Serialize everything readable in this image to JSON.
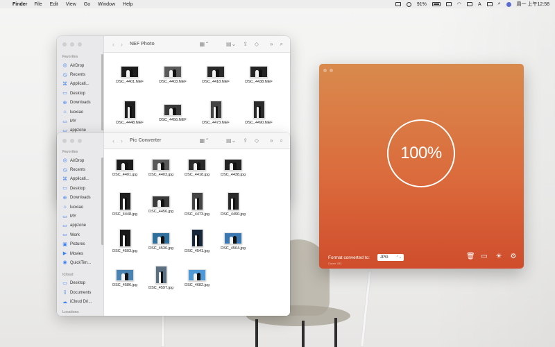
{
  "menubar": {
    "app_name": "Finder",
    "items": [
      "File",
      "Edit",
      "View",
      "Go",
      "Window",
      "Help"
    ],
    "battery_percent": "91%",
    "clock": "周一 上午12:58"
  },
  "finder_top": {
    "title": "NEF Photo",
    "sidebar_section": "Favorites",
    "sidebar_items": [
      {
        "label": "AirDrop",
        "icon": "airdrop-icon"
      },
      {
        "label": "Recents",
        "icon": "clock-icon"
      },
      {
        "label": "Applicati...",
        "icon": "applications-icon"
      },
      {
        "label": "Desktop",
        "icon": "desktop-icon"
      },
      {
        "label": "Downloads",
        "icon": "download-icon"
      },
      {
        "label": "luoxiao",
        "icon": "home-icon"
      },
      {
        "label": "MY",
        "icon": "folder-icon"
      },
      {
        "label": "appzone",
        "icon": "folder-icon"
      }
    ],
    "files": [
      "DSC_4401.NEF",
      "DSC_4403.NEF",
      "DSC_4418.NEF",
      "DSC_4438.NEF",
      "DSC_4448.NEF",
      "DSC_4456.NEF",
      "DSC_4473.NEF",
      "DSC_4490.NEF"
    ]
  },
  "finder_bottom": {
    "title": "Pic Converter",
    "sidebar_section": "Favorites",
    "sidebar_items": [
      {
        "label": "AirDrop",
        "icon": "airdrop-icon"
      },
      {
        "label": "Recents",
        "icon": "clock-icon"
      },
      {
        "label": "Applicati...",
        "icon": "applications-icon"
      },
      {
        "label": "Desktop",
        "icon": "desktop-icon"
      },
      {
        "label": "Downloads",
        "icon": "download-icon"
      },
      {
        "label": "luoxiao",
        "icon": "home-icon"
      },
      {
        "label": "MY",
        "icon": "folder-icon"
      },
      {
        "label": "appzone",
        "icon": "folder-icon"
      },
      {
        "label": "Work",
        "icon": "folder-icon"
      },
      {
        "label": "Pictures",
        "icon": "pictures-icon"
      },
      {
        "label": "Movies",
        "icon": "movies-icon"
      },
      {
        "label": "QuickTim...",
        "icon": "quicktime-icon"
      }
    ],
    "icloud_section": "iCloud",
    "icloud_items": [
      {
        "label": "Desktop",
        "icon": "desktop-icon"
      },
      {
        "label": "Documents",
        "icon": "document-icon"
      },
      {
        "label": "iCloud Dri...",
        "icon": "cloud-icon"
      }
    ],
    "locations_section": "Locations",
    "files": [
      "DSC_4401.jpg",
      "DSC_4403.jpg",
      "DSC_4418.jpg",
      "DSC_4438.jpg",
      "DSC_4448.jpg",
      "DSC_4456.jpg",
      "DSC_4473.jpg",
      "DSC_4490.jpg",
      "DSC_4503.jpg",
      "DSC_4536.jpg",
      "DSC_4541.jpg",
      "DSC_4564.jpg",
      "DSC_4586.jpg",
      "DSC_4597.jpg",
      "DSC_4682.jpg"
    ]
  },
  "converter": {
    "progress_text": "100%",
    "progress_value": 1.0,
    "format_label": "Format converted to:",
    "count_text": "Count: 151",
    "format_selected": "JPG",
    "tools": [
      "trash-icon",
      "folder-icon",
      "lightbulb-icon",
      "gear-icon"
    ]
  },
  "colors": {
    "converter_gradient": [
      "#d98a4d",
      "#db6b3c",
      "#cf4d2c"
    ],
    "sidebar_icon": "#3b82f6"
  }
}
